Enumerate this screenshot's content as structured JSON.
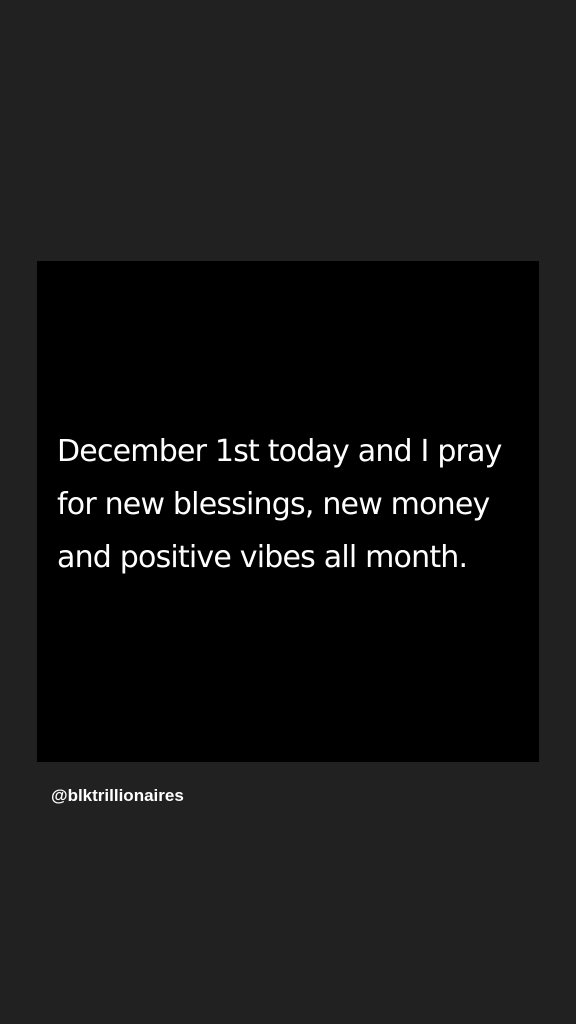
{
  "post": {
    "quote_lines": [
      "December 1st today and I pray",
      "for new blessings, new money",
      "and positive vibes all month."
    ]
  },
  "mention": {
    "handle": "@blktrillionaires"
  },
  "colors": {
    "background": "#212121",
    "card": "#000000",
    "text": "#ffffff"
  }
}
